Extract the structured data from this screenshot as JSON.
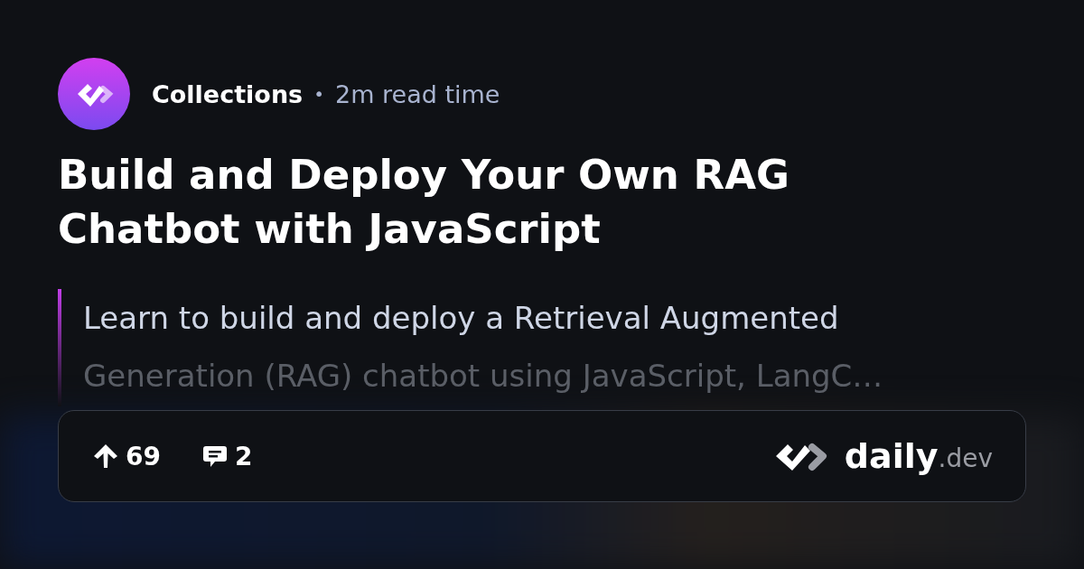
{
  "source": {
    "name": "Collections",
    "separator": "•",
    "read_time": "2m read time"
  },
  "title": "Build and Deploy Your Own RAG Chatbot with JavaScript",
  "description": {
    "lines": [
      "Learn to build and deploy a Retrieval Augmented",
      "Generation (RAG) chatbot using JavaScript, LangC…"
    ]
  },
  "stats": {
    "upvotes": "69",
    "comments": "2"
  },
  "brand": {
    "name": "daily",
    "suffix": ".dev"
  }
}
